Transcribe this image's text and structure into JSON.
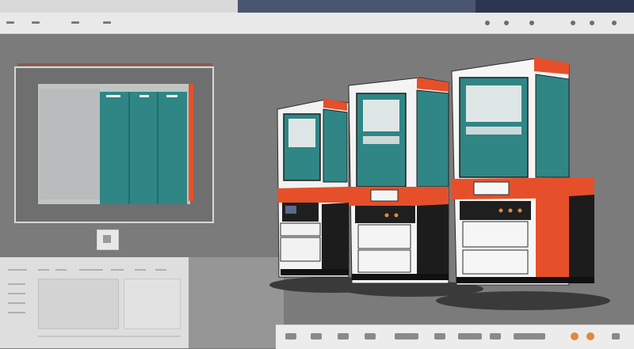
{
  "window": {
    "menu": [
      "",
      "",
      "",
      ""
    ]
  },
  "colors": {
    "teal": "#2f8685",
    "orange": "#e5502a",
    "background": "#7b7b7b",
    "panel": "#e9e9e9"
  },
  "icons": [
    "gear-icon",
    "grid-icon",
    "close-icon",
    "image-icon"
  ]
}
